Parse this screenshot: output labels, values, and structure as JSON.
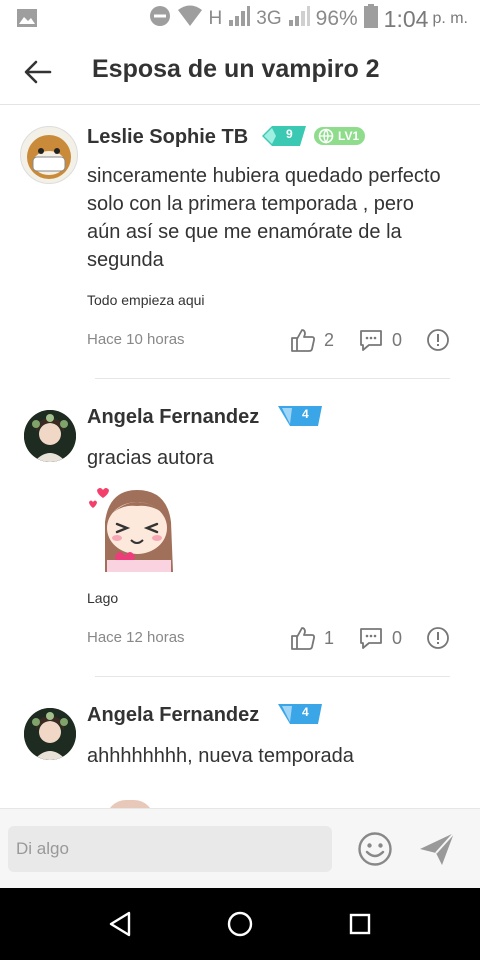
{
  "status_bar": {
    "network_h": "H",
    "network_3g": "3G",
    "battery": "96%",
    "time": "1:04",
    "ampm": "p. m."
  },
  "header": {
    "title": "Esposa de un vampiro 2"
  },
  "comments": [
    {
      "author": "Leslie Sophie TB",
      "rank_badge": "9",
      "level_badge": "LV1",
      "text": "sinceramente hubiera quedado perfecto solo con la primera temporada , pero aún así se que me enamórate de la segunda",
      "subtitle": "Todo empieza aqui",
      "time": "Hace 10 horas",
      "likes": "2",
      "replies": "0"
    },
    {
      "author": "Angela Fernandez",
      "rank_badge": "4",
      "text": "gracias autora",
      "subtitle": "Lago",
      "time": "Hace 12 horas",
      "likes": "1",
      "replies": "0"
    },
    {
      "author": "Angela Fernandez",
      "rank_badge": "4",
      "text": "ahhhhhhhh, nueva temporada"
    }
  ],
  "composer": {
    "placeholder": "Di algo"
  },
  "colors": {
    "accent_teal": "#3cc9b3",
    "accent_blue": "#3aa6e8",
    "level_green": "#8fdc8c"
  }
}
